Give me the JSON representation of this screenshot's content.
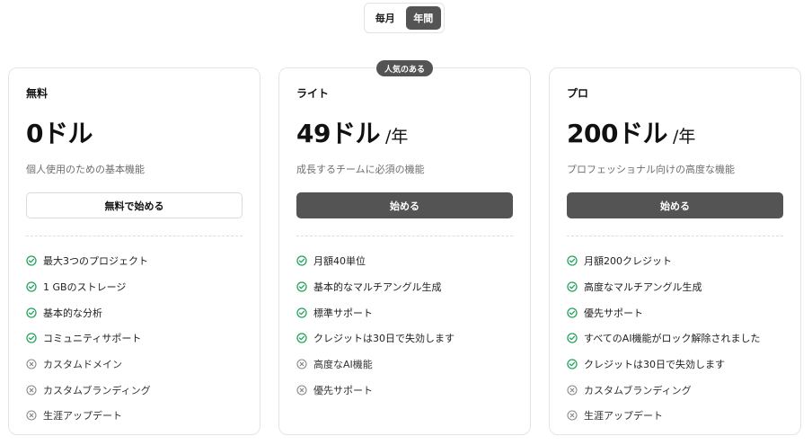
{
  "billing_toggle": {
    "monthly": "毎月",
    "annual": "年間",
    "selected": "annual"
  },
  "colors": {
    "accent_dark": "#545454",
    "check_green": "#22a45d",
    "muted_x": "#8a8a8a"
  },
  "plans": [
    {
      "name": "無料",
      "price": "0ドル",
      "period": "",
      "description": "個人使用のための基本機能",
      "cta": "無料で始める",
      "cta_style": "outline",
      "features": [
        {
          "label": "最大3つのプロジェクト",
          "icon": "check-circle-icon"
        },
        {
          "label": "1 GBのストレージ",
          "icon": "check-circle-icon"
        },
        {
          "label": "基本的な分析",
          "icon": "check-circle-icon"
        },
        {
          "label": "コミュニティサポート",
          "icon": "check-circle-icon"
        },
        {
          "label": "カスタムドメイン",
          "icon": "x-circle-icon"
        },
        {
          "label": "カスタムブランディング",
          "icon": "x-circle-icon"
        },
        {
          "label": "生涯アップデート",
          "icon": "x-circle-icon"
        }
      ]
    },
    {
      "name": "ライト",
      "badge": "人気のある",
      "price": "49ドル",
      "period": "/年",
      "description": "成長するチームに必須の機能",
      "cta": "始める",
      "cta_style": "filled",
      "features": [
        {
          "label": "月額40単位",
          "icon": "check-circle-icon"
        },
        {
          "label": "基本的なマルチアングル生成",
          "icon": "check-circle-icon"
        },
        {
          "label": "標準サポート",
          "icon": "check-circle-icon"
        },
        {
          "label": "クレジットは30日で失効します",
          "icon": "check-circle-icon"
        },
        {
          "label": "高度なAI機能",
          "icon": "x-circle-icon"
        },
        {
          "label": "優先サポート",
          "icon": "x-circle-icon"
        }
      ]
    },
    {
      "name": "プロ",
      "price": "200ドル",
      "period": "/年",
      "description": "プロフェッショナル向けの高度な機能",
      "cta": "始める",
      "cta_style": "filled",
      "features": [
        {
          "label": "月額200クレジット",
          "icon": "check-circle-icon"
        },
        {
          "label": "高度なマルチアングル生成",
          "icon": "check-circle-icon"
        },
        {
          "label": "優先サポート",
          "icon": "check-circle-icon"
        },
        {
          "label": "すべてのAI機能がロック解除されました",
          "icon": "check-circle-icon"
        },
        {
          "label": "クレジットは30日で失効します",
          "icon": "check-circle-icon"
        },
        {
          "label": "カスタムブランディング",
          "icon": "x-circle-icon"
        },
        {
          "label": "生涯アップデート",
          "icon": "x-circle-icon"
        }
      ]
    }
  ]
}
